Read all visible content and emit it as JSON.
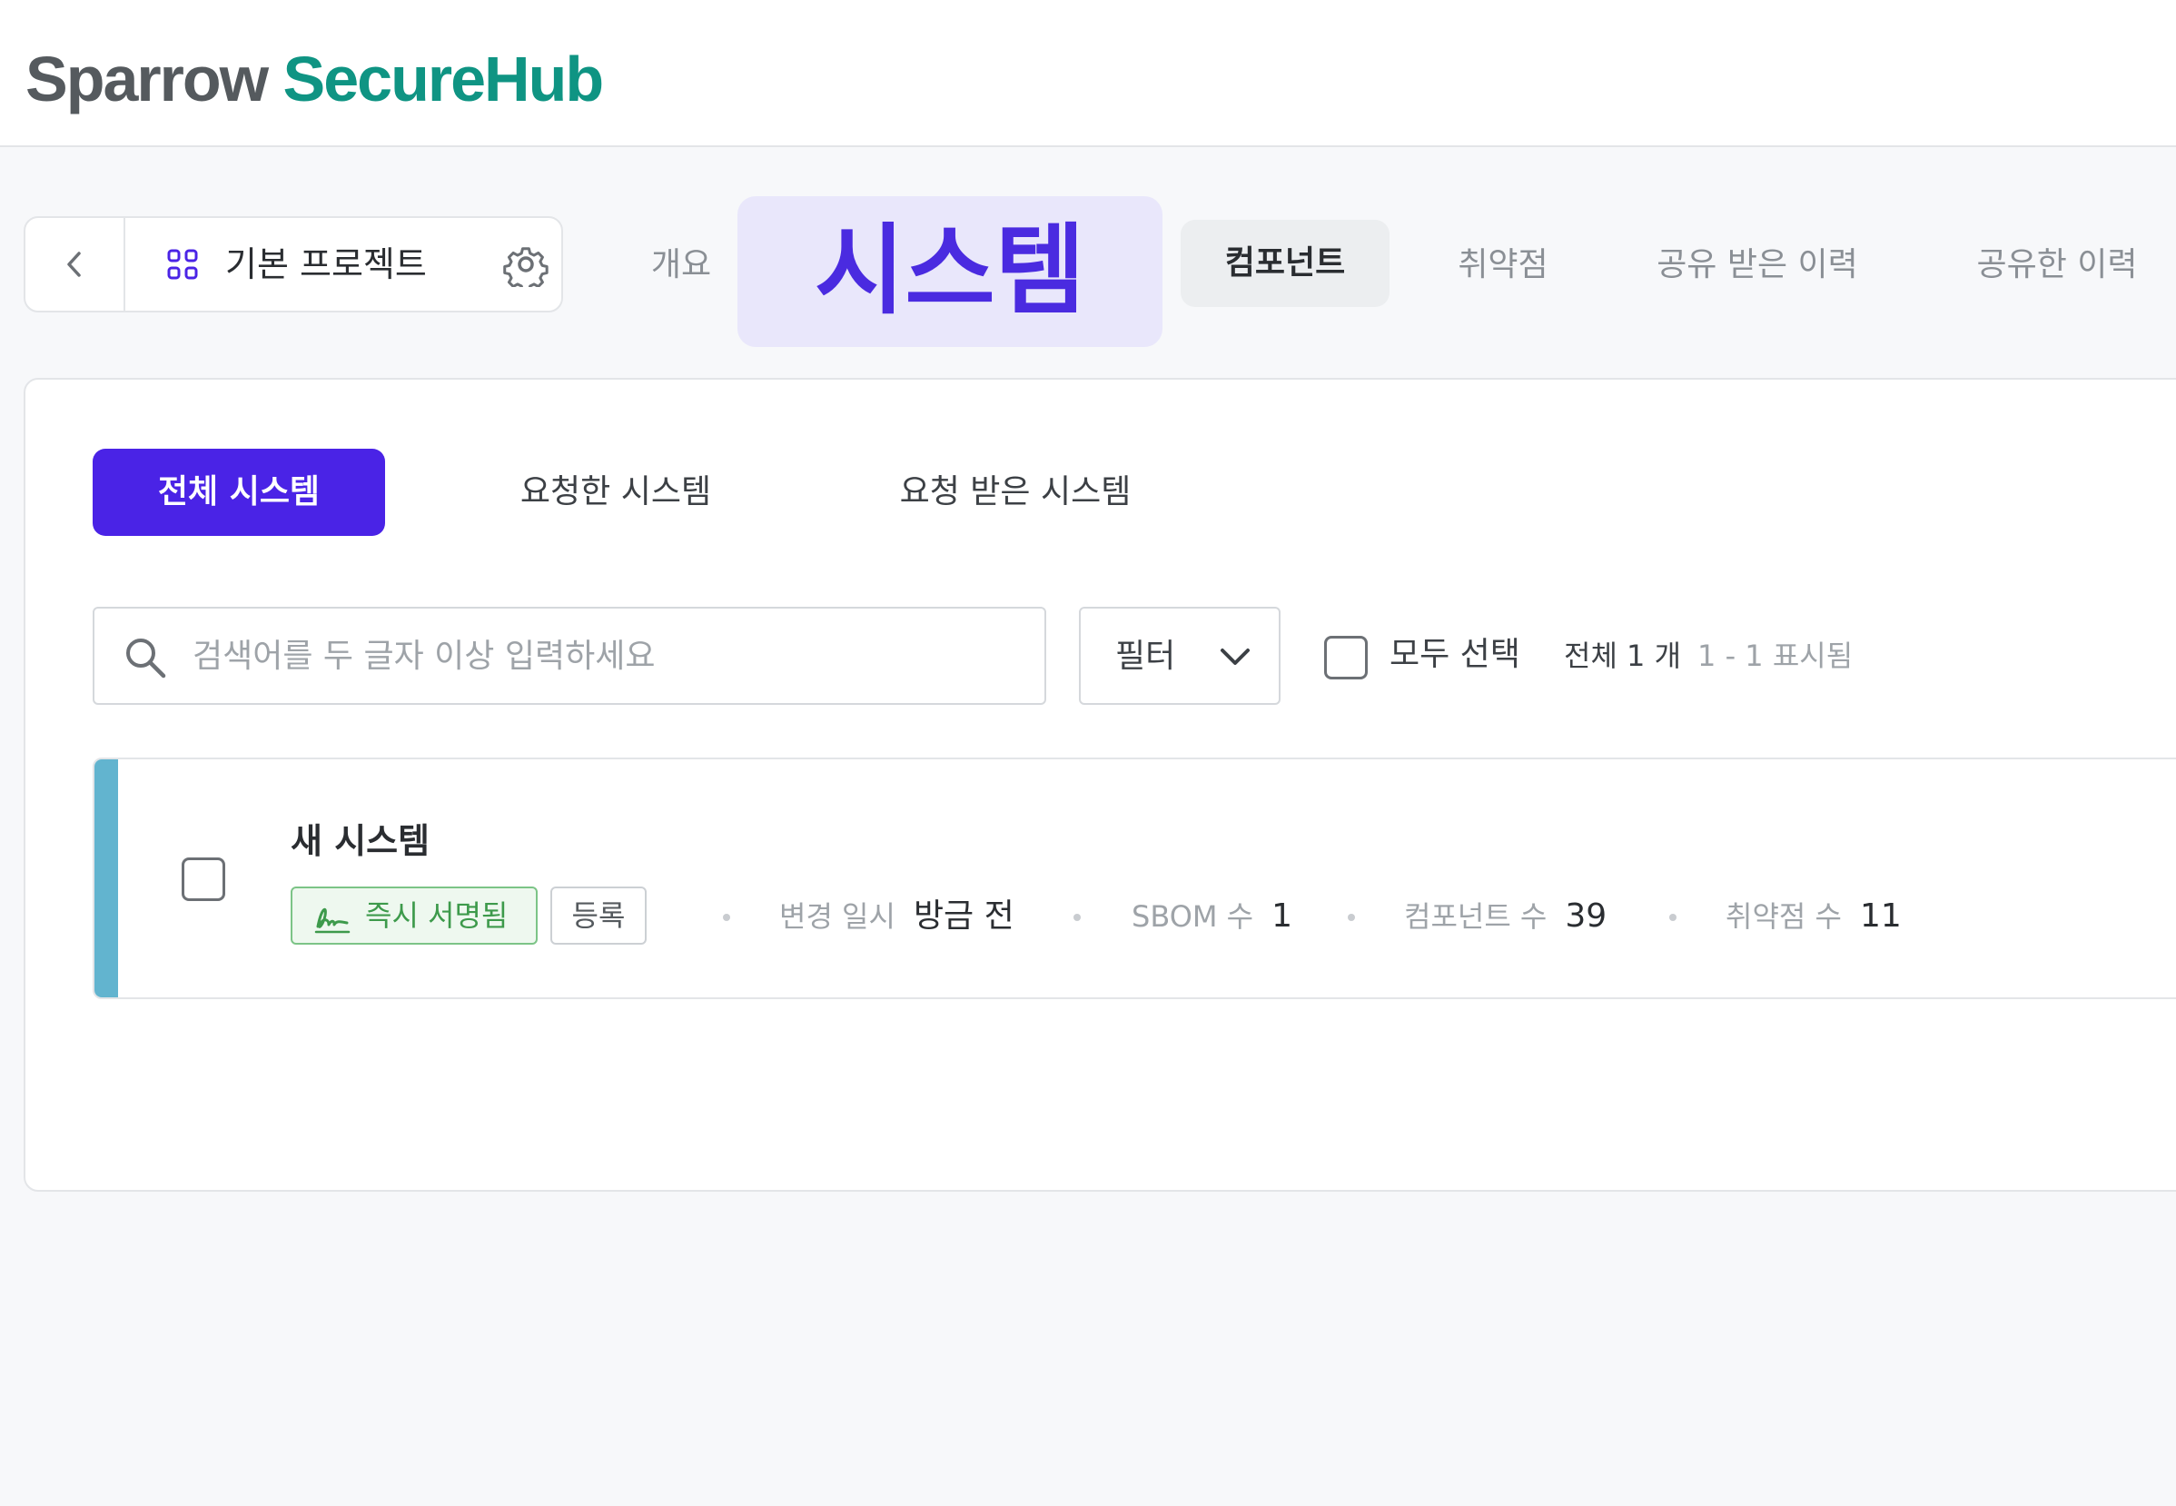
{
  "header": {
    "logo_part1": "Sparrow",
    "logo_part2": "SecureHub"
  },
  "project": {
    "name": "기본 프로젝트"
  },
  "top_tabs": [
    {
      "label": "개요"
    },
    {
      "label": "시스템",
      "active": true
    },
    {
      "label": "컴포넌트"
    },
    {
      "label": "취약점"
    },
    {
      "label": "공유 받은 이력"
    },
    {
      "label": "공유한 이력"
    }
  ],
  "sub_tabs": [
    {
      "label": "전체 시스템",
      "active": true
    },
    {
      "label": "요청한 시스템"
    },
    {
      "label": "요청 받은 시스템"
    }
  ],
  "search": {
    "placeholder": "검색어를 두 글자 이상 입력하세요",
    "value": ""
  },
  "filter": {
    "label": "필터"
  },
  "select_all": {
    "label": "모두 선택",
    "checked": false
  },
  "summary": {
    "total": "전체 1 개",
    "range": "1 - 1 표시됨"
  },
  "systems": [
    {
      "name": "새 시스템",
      "sign_badge": "즉시 서명됨",
      "type_badge": "등록",
      "changed_label": "변경 일시",
      "changed_value": "방금 전",
      "sbom_label": "SBOM 수",
      "sbom_value": "1",
      "component_label": "컴포넌트 수",
      "component_value": "39",
      "vuln_label": "취약점 수",
      "vuln_value": "11",
      "checked": false
    }
  ],
  "colors": {
    "brand_dark": "#555a5e",
    "brand_accent": "#0f9483",
    "primary": "#4a23e6",
    "highlight_bg": "#e9e7fb",
    "row_accent": "#62b4cf",
    "sign_green": "#3d9a4b"
  },
  "icons": [
    "chevron-left-icon",
    "grid-icon",
    "gear-icon",
    "search-icon",
    "chevron-down-icon",
    "signature-icon"
  ]
}
